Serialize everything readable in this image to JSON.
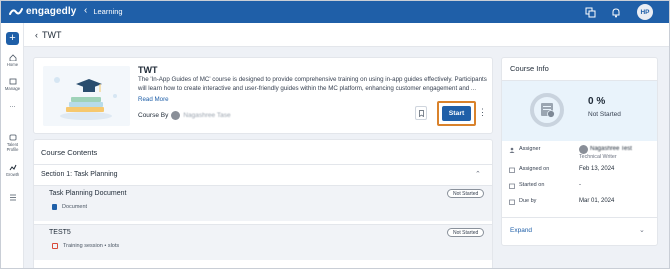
{
  "topbar": {
    "app_name": "engagedly",
    "back_label": "Learning",
    "user_initials": "HP",
    "colors": {
      "brand": "#1f5fa8"
    }
  },
  "sidebar": {
    "items": [
      {
        "label": "Home",
        "icon": "home-icon"
      },
      {
        "label": "Manage",
        "icon": "manage-icon"
      },
      {
        "label": "...",
        "icon": "more-icon"
      },
      {
        "label": "Talent Profile",
        "icon": "talent-profile-icon"
      },
      {
        "label": "Growth",
        "icon": "growth-icon"
      }
    ]
  },
  "page": {
    "title": "TWT"
  },
  "course": {
    "title": "TWT",
    "description": "The 'In-App Guides of MC' course is designed to provide comprehensive training on using in-app guides effectively. Participants will learn how to create interactive and user-friendly guides within the MC platform, enhancing customer engagement and ...",
    "read_more": "Read More",
    "by_label": "Course By",
    "author_name": "Nagashree Tase",
    "start_label": "Start"
  },
  "contents": {
    "title": "Course Contents",
    "section": "Section 1: Task Planning",
    "items": [
      {
        "title": "Task Planning Document",
        "sub": "Document",
        "status": "Not Started"
      },
      {
        "title": "TEST5",
        "sub": "Training session • slots",
        "status": "Not Started"
      }
    ]
  },
  "info": {
    "title": "Course Info",
    "progress_percent": "0 %",
    "progress_value": 0,
    "status": "Not Started",
    "assigner_label": "Assigner",
    "assigner_name": "Nagashree Test",
    "assigner_role": "Technical Writer",
    "assigned_on_label": "Assigned on",
    "assigned_on": "Feb 13, 2024",
    "started_on_label": "Started on",
    "started_on": "-",
    "due_by_label": "Due by",
    "due_by": "Mar 01, 2024",
    "expand_label": "Expand"
  }
}
